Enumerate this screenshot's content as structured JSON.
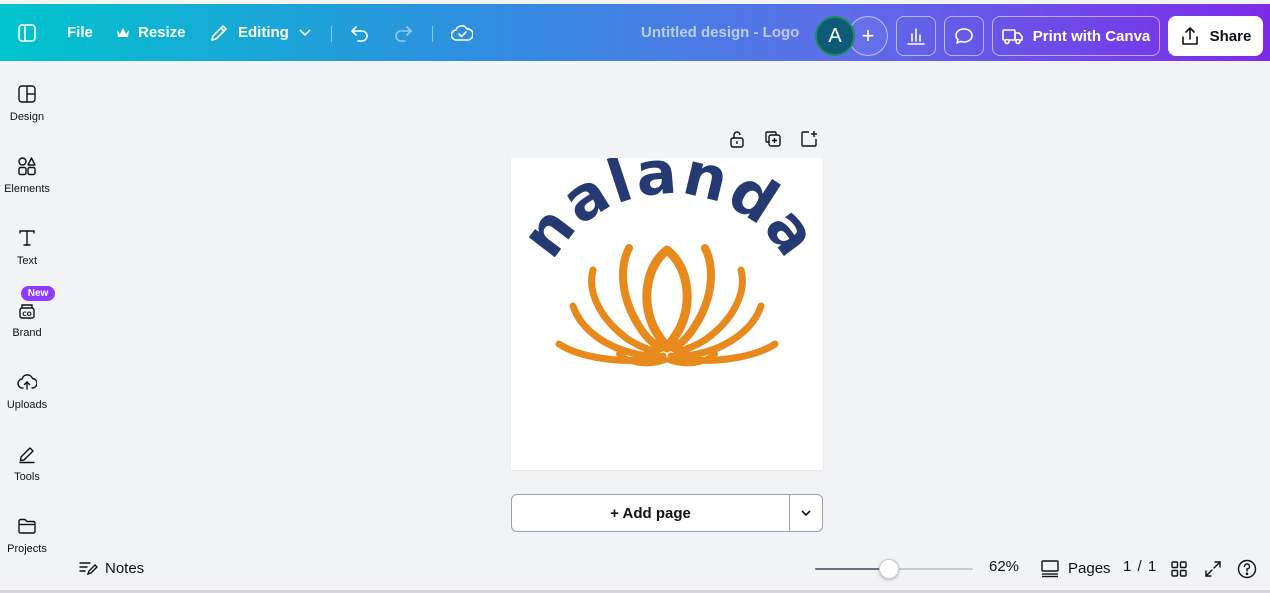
{
  "topbar": {
    "file_label": "File",
    "resize_label": "Resize",
    "editing_label": "Editing",
    "doc_title": "Untitled design - Logo",
    "avatar_initial": "A",
    "add_collaborator": "+",
    "print_label": "Print with Canva",
    "share_label": "Share"
  },
  "sidebar": {
    "items": [
      {
        "label": "Design",
        "icon": "design-icon"
      },
      {
        "label": "Elements",
        "icon": "elements-icon"
      },
      {
        "label": "Text",
        "icon": "text-icon"
      },
      {
        "label": "Brand",
        "icon": "brand-icon"
      },
      {
        "label": "Uploads",
        "icon": "uploads-icon"
      },
      {
        "label": "Tools",
        "icon": "tools-icon"
      },
      {
        "label": "Projects",
        "icon": "projects-icon"
      }
    ],
    "new_badge": "New"
  },
  "canvas": {
    "logo_word": "nalanda",
    "logo_colors": {
      "word": "#253a73",
      "lotus": "#e8891c"
    },
    "add_page_label": "+ Add page"
  },
  "bottombar": {
    "notes_label": "Notes",
    "zoom_percent": 62,
    "zoom_label": "62%",
    "pages_label": "Pages",
    "page_count": "1 / 1"
  },
  "colors": {
    "accent_purple": "#8b3dff",
    "gradient_start": "#00c4cc",
    "gradient_end": "#7d2ae8"
  }
}
